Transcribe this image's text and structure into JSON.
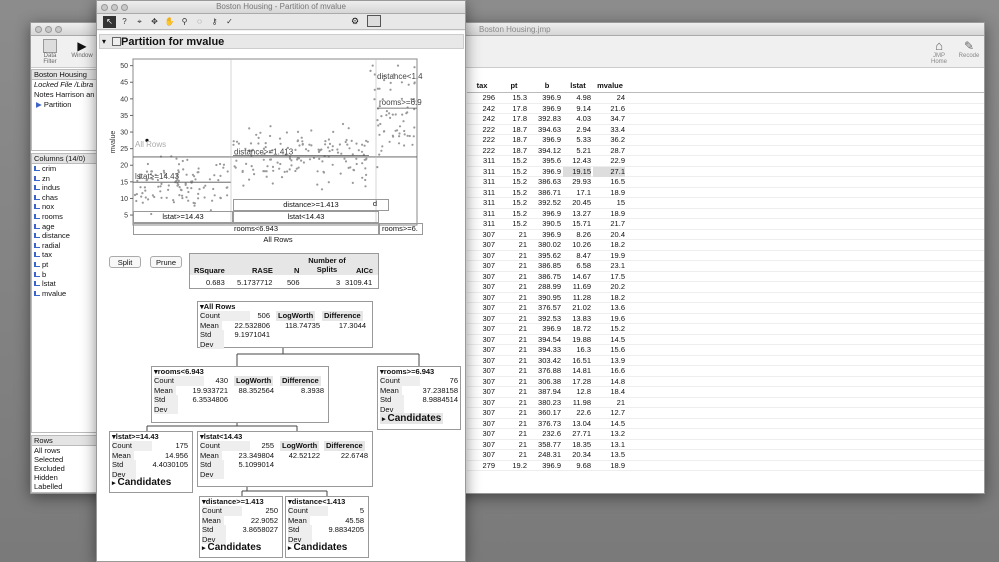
{
  "partition_window": {
    "title": "Boston Housing - Partition of mvalue",
    "report_title": "Partition for mvalue",
    "tools": [
      "arrow-tool",
      "help-tool",
      "crosshair-tool",
      "move-tool",
      "hand-tool",
      "brush-tool",
      "lasso-tool",
      "magnifier-tool",
      "annotate-tool",
      "line-tool"
    ],
    "split_label": "Split",
    "prune_label": "Prune",
    "summary": {
      "headers": [
        "RSquare",
        "RASE",
        "N",
        "Number of Splits",
        "AICc"
      ],
      "values": [
        "0.683",
        "5.1737712",
        "506",
        "3",
        "3109.41"
      ]
    },
    "plot": {
      "ylabel": "mvalue",
      "y_ticks": [
        "50",
        "45",
        "40",
        "35",
        "30",
        "25",
        "20",
        "15",
        "10",
        "5"
      ],
      "labels": {
        "all_rows": "All Rows",
        "distance_lt": "distance<1.4",
        "rooms_ge": "rooms>=6.9",
        "distance_ge": "distance>=1.413",
        "lstat_ge": "lstat>=14.43"
      }
    },
    "axis_rows": {
      "row1": [
        "distance>=1.413",
        "d"
      ],
      "row2": [
        "lstat>=14.43",
        "lstat<14.43"
      ],
      "row3": [
        "rooms<6.943",
        "rooms>=6."
      ],
      "row4": "All Rows"
    },
    "nodes": {
      "all_rows": {
        "title": "All Rows",
        "count": "506",
        "mean": "22.532806",
        "std": "9.1971041",
        "logworth": "118.74735",
        "difference": "17.3044"
      },
      "rooms_lt": {
        "title": "rooms<6.943",
        "count": "430",
        "mean": "19.933721",
        "std": "6.3534806",
        "logworth": "88.352564",
        "difference": "8.3938"
      },
      "rooms_ge": {
        "title": "rooms>=6.943",
        "count": "76",
        "mean": "37.238158",
        "std": "8.9884514"
      },
      "lstat_ge": {
        "title": "lstat>=14.43",
        "count": "175",
        "mean": "14.956",
        "std": "4.4030105"
      },
      "lstat_lt": {
        "title": "lstat<14.43",
        "count": "255",
        "mean": "23.349804",
        "std": "5.1099014",
        "logworth": "42.52122",
        "difference": "22.6748"
      },
      "dist_ge": {
        "title": "distance>=1.413",
        "count": "250",
        "mean": "22.9052",
        "std": "3.8658027"
      },
      "dist_lt": {
        "title": "distance<1.413",
        "count": "5",
        "mean": "45.58",
        "std": "9.8834205"
      }
    },
    "stat_labels": {
      "count": "Count",
      "mean": "Mean",
      "std": "Std Dev",
      "logworth": "LogWorth",
      "difference": "Difference",
      "candidates": "Candidates"
    }
  },
  "data_window": {
    "title": "Boston Housing.jmp",
    "toolbar": {
      "data_filter": "Data Filter",
      "window": "Window",
      "jmp_home": "JMP Home",
      "recode": "Recode"
    },
    "table_panel": {
      "name": "Boston Housing",
      "locked": "Locked File  /Libra",
      "notes": "Notes  Harrison an",
      "script": "Partition"
    },
    "columns_panel": {
      "header": "Columns (14/0)",
      "items": [
        "crim",
        "zn",
        "indus",
        "chas",
        "nox",
        "rooms",
        "age",
        "distance",
        "radial",
        "tax",
        "pt",
        "b",
        "lstat",
        "mvalue"
      ]
    },
    "rows_panel": {
      "header": "Rows",
      "items": [
        "All rows",
        "Selected",
        "Excluded",
        "Hidden",
        "Labelled"
      ]
    },
    "column_headers": [
      "tax",
      "pt",
      "b",
      "lstat",
      "mvalue"
    ],
    "rows": [
      [
        "296",
        "15.3",
        "396.9",
        "4.98",
        "24"
      ],
      [
        "242",
        "17.8",
        "396.9",
        "9.14",
        "21.6"
      ],
      [
        "242",
        "17.8",
        "392.83",
        "4.03",
        "34.7"
      ],
      [
        "222",
        "18.7",
        "394.63",
        "2.94",
        "33.4"
      ],
      [
        "222",
        "18.7",
        "396.9",
        "5.33",
        "36.2"
      ],
      [
        "222",
        "18.7",
        "394.12",
        "5.21",
        "28.7"
      ],
      [
        "311",
        "15.2",
        "395.6",
        "12.43",
        "22.9"
      ],
      [
        "311",
        "15.2",
        "396.9",
        "19.15",
        "27.1"
      ],
      [
        "311",
        "15.2",
        "386.63",
        "29.93",
        "16.5"
      ],
      [
        "311",
        "15.2",
        "386.71",
        "17.1",
        "18.9"
      ],
      [
        "311",
        "15.2",
        "392.52",
        "20.45",
        "15"
      ],
      [
        "311",
        "15.2",
        "396.9",
        "13.27",
        "18.9"
      ],
      [
        "311",
        "15.2",
        "390.5",
        "15.71",
        "21.7"
      ],
      [
        "307",
        "21",
        "396.9",
        "8.26",
        "20.4"
      ],
      [
        "307",
        "21",
        "380.02",
        "10.26",
        "18.2"
      ],
      [
        "307",
        "21",
        "395.62",
        "8.47",
        "19.9"
      ],
      [
        "307",
        "21",
        "386.85",
        "6.58",
        "23.1"
      ],
      [
        "307",
        "21",
        "386.75",
        "14.67",
        "17.5"
      ],
      [
        "307",
        "21",
        "288.99",
        "11.69",
        "20.2"
      ],
      [
        "307",
        "21",
        "390.95",
        "11.28",
        "18.2"
      ],
      [
        "307",
        "21",
        "376.57",
        "21.02",
        "13.6"
      ],
      [
        "307",
        "21",
        "392.53",
        "13.83",
        "19.6"
      ],
      [
        "307",
        "21",
        "396.9",
        "18.72",
        "15.2"
      ],
      [
        "307",
        "21",
        "394.54",
        "19.88",
        "14.5"
      ],
      [
        "307",
        "21",
        "394.33",
        "16.3",
        "15.6"
      ],
      [
        "307",
        "21",
        "303.42",
        "16.51",
        "13.9"
      ],
      [
        "307",
        "21",
        "376.88",
        "14.81",
        "16.6"
      ],
      [
        "307",
        "21",
        "306.38",
        "17.28",
        "14.8"
      ],
      [
        "307",
        "21",
        "387.94",
        "12.8",
        "18.4"
      ],
      [
        "307",
        "21",
        "380.23",
        "11.98",
        "21"
      ],
      [
        "307",
        "21",
        "360.17",
        "22.6",
        "12.7"
      ],
      [
        "307",
        "21",
        "376.73",
        "13.04",
        "14.5"
      ],
      [
        "307",
        "21",
        "232.6",
        "27.71",
        "13.2"
      ],
      [
        "307",
        "21",
        "358.77",
        "18.35",
        "13.1"
      ],
      [
        "307",
        "21",
        "248.31",
        "20.34",
        "13.5"
      ],
      [
        "279",
        "19.2",
        "396.9",
        "9.68",
        "18.9"
      ]
    ]
  }
}
